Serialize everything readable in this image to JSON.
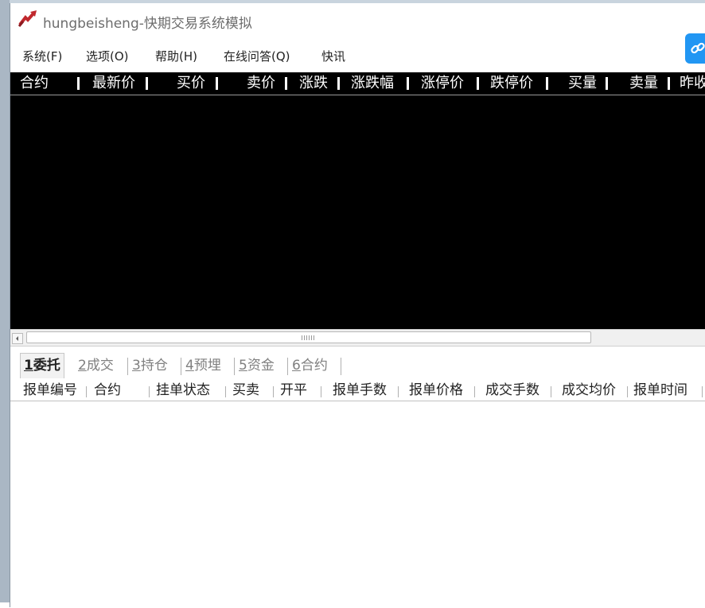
{
  "window": {
    "title": "hungbeisheng-快期交易系统模拟"
  },
  "menu": [
    "系统(F)",
    "选项(O)",
    "帮助(H)",
    "在线问答(Q)",
    "快讯"
  ],
  "quote_table": {
    "columns": [
      "合约",
      "最新价",
      "买价",
      "卖价",
      "涨跌",
      "涨跌幅",
      "涨停价",
      "跌停价",
      "买量",
      "卖量",
      "昨收"
    ],
    "rows": []
  },
  "tabs": [
    {
      "key": "1",
      "label": "委托",
      "active": true
    },
    {
      "key": "2",
      "label": "成交",
      "active": false
    },
    {
      "key": "3",
      "label": "持仓",
      "active": false
    },
    {
      "key": "4",
      "label": "预埋",
      "active": false
    },
    {
      "key": "5",
      "label": "资金",
      "active": false
    },
    {
      "key": "6",
      "label": "合约",
      "active": false
    }
  ],
  "orders_table": {
    "columns": [
      "报单编号",
      "合约",
      "挂单状态",
      "买卖",
      "开平",
      "报单手数",
      "报单价格",
      "成交手数",
      "成交均价",
      "报单时间"
    ],
    "rows": []
  },
  "icons": {
    "app": "rising-chart-arrow-icon",
    "top_right": "link-icon",
    "scroll_left": "arrow-left-icon"
  },
  "colors": {
    "accent": "#2196f3",
    "quote_bg": "#000000",
    "quote_text": "#ffffff",
    "app_icon": "#c0282d"
  }
}
